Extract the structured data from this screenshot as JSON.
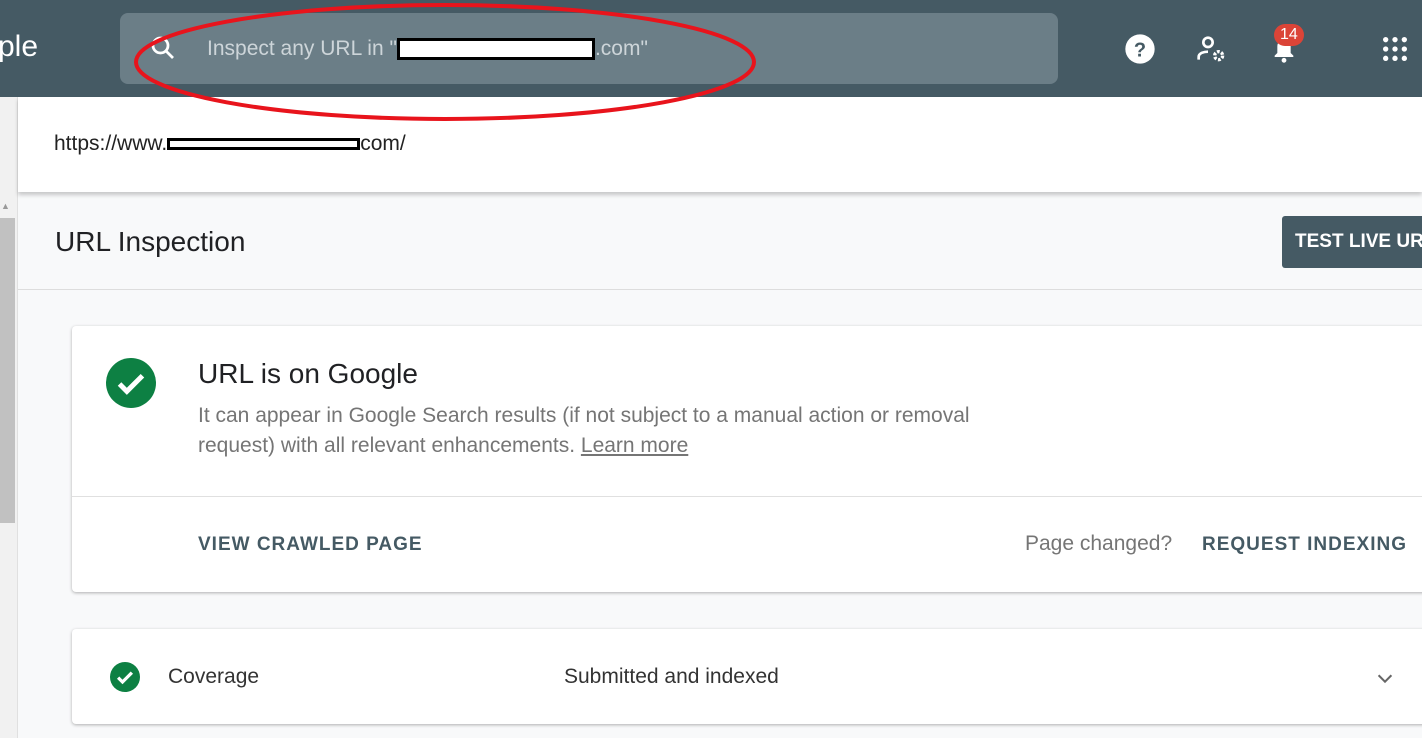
{
  "header": {
    "logo_partial": "ple",
    "search_placeholder_prefix": "Inspect any URL in \"",
    "search_placeholder_suffix": ".com\"",
    "notification_count": "14",
    "icons": [
      "search-icon",
      "help-icon",
      "manage-users-icon",
      "bell-icon",
      "apps-grid-icon"
    ]
  },
  "url_bar": {
    "prefix": "https://www.",
    "suffix": "com/"
  },
  "page": {
    "title": "URL Inspection",
    "test_live_button": "TEST LIVE URL"
  },
  "status_card": {
    "title": "URL is on Google",
    "description": "It can appear in Google Search results (if not subject to a manual action or removal request) with all relevant enhancements.",
    "learn_more": "Learn more",
    "view_crawled": "VIEW CRAWLED PAGE",
    "page_changed": "Page changed?",
    "request_indexing": "REQUEST INDEXING"
  },
  "coverage": {
    "label": "Coverage",
    "value": "Submitted and indexed"
  },
  "colors": {
    "header": "#455a64",
    "success": "#0d8043",
    "badge": "#db4437",
    "annotation": "#e8141c"
  }
}
